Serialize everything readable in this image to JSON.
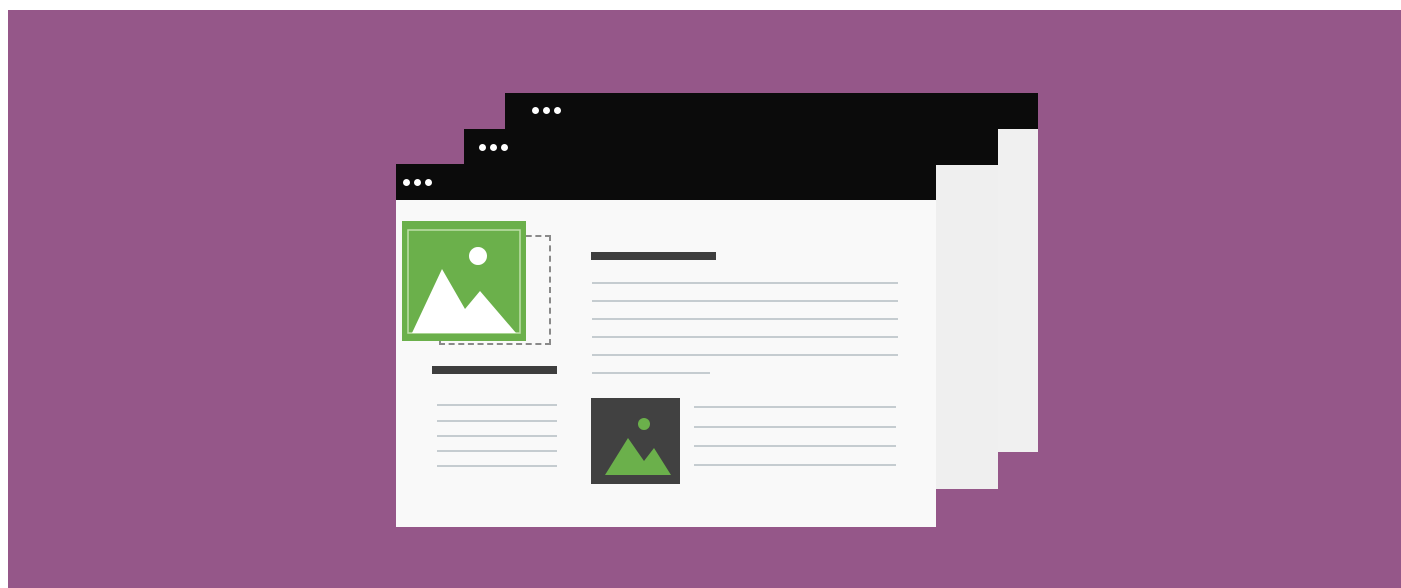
{
  "colors": {
    "background": "#955789",
    "titlebar": "#0b0b0b",
    "window_body": "#f9f9f9",
    "window_back": "#f0f0f0",
    "accent_green": "#6bb04b",
    "dark_thumb": "#414141",
    "heading_bar": "#3e3e3e",
    "text_line": "#c5ccd0"
  },
  "illustration": {
    "windows": [
      {
        "name": "back-window",
        "dots": 3
      },
      {
        "name": "middle-window",
        "dots": 3
      },
      {
        "name": "front-window",
        "dots": 3
      }
    ],
    "icons": [
      "image-placeholder-icon",
      "image-placeholder-icon"
    ]
  }
}
